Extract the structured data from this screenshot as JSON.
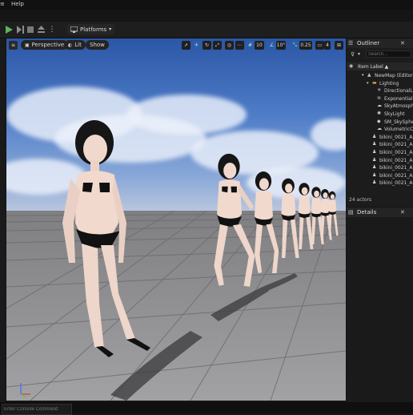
{
  "menu": {
    "help_label": "Help"
  },
  "toolbar": {
    "platforms_label": "Platforms"
  },
  "viewport": {
    "perspective_label": "Perspective",
    "lit_label": "Lit",
    "show_label": "Show",
    "grid_snap_value": "10",
    "rotation_snap_value": "10°",
    "scale_snap_value": "0.25",
    "camera_speed_value": "4"
  },
  "outliner": {
    "tab_label": "Outliner",
    "search_placeholder": "Search...",
    "column_label": "Item Label ▲",
    "rows": [
      {
        "label": "NewMap (Editor)",
        "indent": 0,
        "icon": "map-icon"
      },
      {
        "label": "Lighting",
        "indent": 1,
        "icon": "folder-icon"
      },
      {
        "label": "DirectionalLig",
        "indent": 2,
        "icon": "light-icon"
      },
      {
        "label": "ExponentialHe",
        "indent": 2,
        "icon": "fog-icon"
      },
      {
        "label": "SkyAtmosphe",
        "indent": 2,
        "icon": "atmosphere-icon"
      },
      {
        "label": "SkyLight",
        "indent": 2,
        "icon": "skylight-icon"
      },
      {
        "label": "SM_SkySphe",
        "indent": 2,
        "icon": "mesh-icon"
      },
      {
        "label": "VolumetricClo",
        "indent": 2,
        "icon": "cloud-icon"
      },
      {
        "label": "bikini_0021_Ani",
        "indent": 1,
        "icon": "person-icon"
      },
      {
        "label": "bikini_0021_Ani",
        "indent": 1,
        "icon": "person-icon"
      },
      {
        "label": "bikini_0021_Ani",
        "indent": 1,
        "icon": "person-icon"
      },
      {
        "label": "bikini_0021_Ani",
        "indent": 1,
        "icon": "person-icon"
      },
      {
        "label": "bikini_0021_Ani",
        "indent": 1,
        "icon": "person-icon"
      },
      {
        "label": "bikini_0021_Ani",
        "indent": 1,
        "icon": "person-icon"
      },
      {
        "label": "bikini_0021_Ani",
        "indent": 1,
        "icon": "person-icon"
      }
    ],
    "actor_count": "24 actors"
  },
  "details": {
    "tab_label": "Details"
  },
  "status": {
    "cmd_placeholder": "Enter Console Command"
  },
  "colors": {
    "accent": "#2a5fa8",
    "play_green": "#5fb35a",
    "folder": "#d8a94a"
  }
}
